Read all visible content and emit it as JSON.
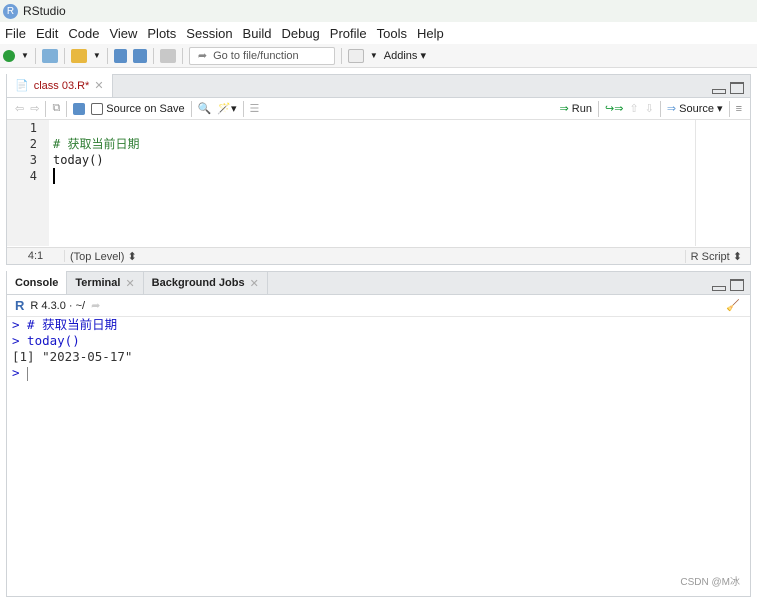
{
  "window": {
    "title": "RStudio"
  },
  "menu": [
    "File",
    "Edit",
    "Code",
    "View",
    "Plots",
    "Session",
    "Build",
    "Debug",
    "Profile",
    "Tools",
    "Help"
  ],
  "toolbar": {
    "goto_placeholder": "Go to file/function",
    "addins": "Addins"
  },
  "editor": {
    "tab": "class 03.R*",
    "source_on_save": "Source on Save",
    "run": "Run",
    "source": "Source",
    "line_numbers": [
      "1",
      "2",
      "3",
      "4"
    ],
    "lines": [
      "",
      "# 获取当前日期",
      "today()",
      ""
    ],
    "status": {
      "position": "4:1",
      "scope": "(Top Level) ⬍",
      "filetype": "R Script ⬍"
    }
  },
  "console_pane": {
    "tabs": [
      "Console",
      "Terminal",
      "Background Jobs"
    ],
    "version": "R 4.3.0 · ~/",
    "output": [
      {
        "prompt": ">",
        "text": " # 获取当前日期",
        "kind": "input"
      },
      {
        "prompt": ">",
        "text": " today()",
        "kind": "input"
      },
      {
        "prompt": "",
        "text": "[1] \"2023-05-17\"",
        "kind": "output"
      },
      {
        "prompt": ">",
        "text": "",
        "kind": "input"
      }
    ]
  },
  "watermark": "CSDN @M冰",
  "colors": {
    "comment": "#2e7d32",
    "console_input": "#1515c8",
    "tab_modified": "#a01010"
  }
}
